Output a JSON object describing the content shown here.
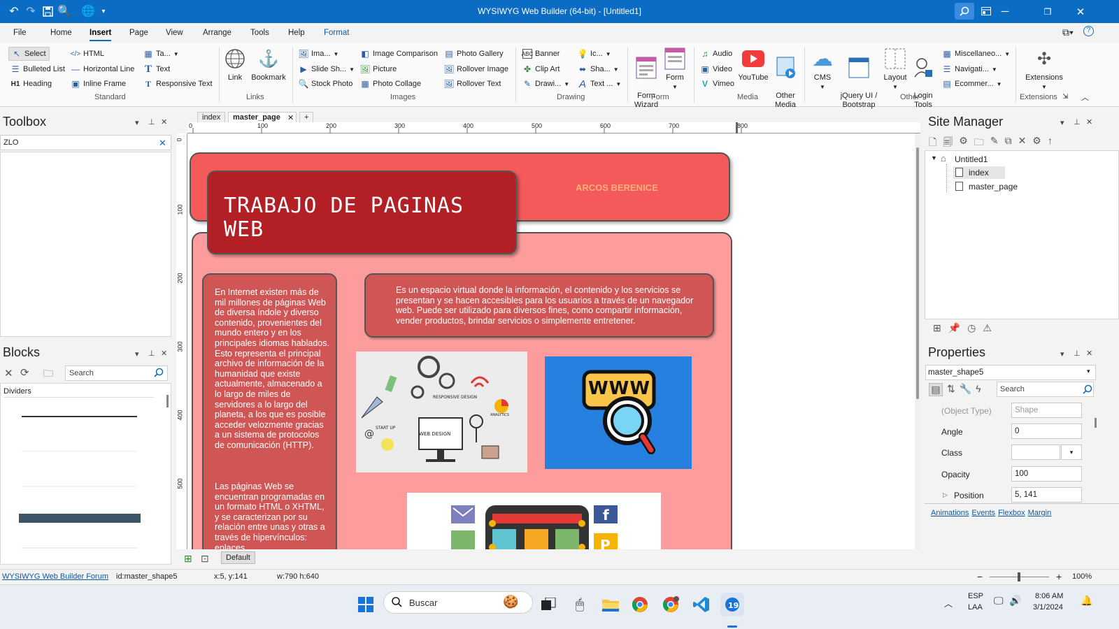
{
  "app": {
    "title": "WYSIWYG Web Builder (64-bit) - [Untitled1]"
  },
  "menu": [
    "File",
    "Home",
    "Insert",
    "Page",
    "View",
    "Arrange",
    "Tools",
    "Help",
    "Format"
  ],
  "ribbon": {
    "standard": {
      "select": "Select",
      "html": "HTML",
      "table": "Ta...",
      "bulleted_list": "Bulleted List",
      "horizontal_line": "Horizontal Line",
      "text": "Text",
      "heading": "Heading",
      "inline_frame": "Inline Frame",
      "responsive_text": "Responsive Text",
      "group": "Standard"
    },
    "links": {
      "link": "Link",
      "bookmark": "Bookmark",
      "group": "Links"
    },
    "images": {
      "image": "Ima...",
      "slide_show": "Slide Sh...",
      "stock_photo": "Stock Photo",
      "image_comparison": "Image Comparison",
      "picture": "Picture",
      "photo_collage": "Photo Collage",
      "photo_gallery": "Photo Gallery",
      "rollover_image": "Rollover Image",
      "rollover_text": "Rollover Text",
      "group": "Images"
    },
    "drawing": {
      "banner": "Banner",
      "clip_art": "Clip Art",
      "drawing": "Drawi...",
      "icon": "Ic...",
      "shape": "Sha...",
      "text_art": "Text ...",
      "group": "Drawing"
    },
    "form": {
      "form_wizard": "Form\nWizard",
      "form": "Form",
      "group": "Form"
    },
    "media": {
      "audio": "Audio",
      "video": "Video",
      "vimeo": "Vimeo",
      "youtube": "YouTube",
      "other_media": "Other\nMedia",
      "group": "Media"
    },
    "other": {
      "cms": "CMS",
      "jquery": "jQuery UI /\nBootstrap",
      "layout": "Layout",
      "login_tools": "Login\nTools",
      "miscellaneous": "Miscellaneo...",
      "navigation": "Navigati...",
      "ecommerce": "Ecommer...",
      "group": "Other"
    },
    "extensions": {
      "extensions": "Extensions",
      "group": "Extensions"
    }
  },
  "toolbox": {
    "title": "Toolbox",
    "search_value": "ZLO"
  },
  "blocks": {
    "title": "Blocks",
    "search_placeholder": "Search",
    "category": "Dividers"
  },
  "tabs": [
    "index",
    "master_page",
    "+"
  ],
  "ruler": {
    "h_ticks": [
      "0",
      "100",
      "200",
      "300",
      "400",
      "500",
      "600",
      "700",
      "800"
    ],
    "v_ticks": [
      "0",
      "100",
      "200",
      "300",
      "400",
      "500"
    ]
  },
  "page_content": {
    "header_name": "ARCOS BERENICE",
    "title": "TRABAJO DE PAGINAS WEB",
    "left_text_1": "En Internet existen más de mil millones de páginas Web de diversa índole y diverso contenido, provenientes del mundo entero y en los principales idiomas hablados. Esto representa el principal archivo de información de la humanidad que existe actualmente, almacenado a lo largo de miles de servidores a lo largo del planeta, a los que es posible acceder velozmente gracias a un sistema de protocolos de comunicación (HTTP).",
    "left_text_2": "Las páginas Web se encuentran programadas en un formato HTML o XHTML, y se caracterizan por su relación entre unas y otras a través de hipervínculos: enlaces",
    "right_text": "Es un espacio virtual donde la información, el contenido y los servicios se presentan y se hacen accesibles para los usuarios a través de un navegador web. Puede ser utilizado para diversos fines, como compartir información, vender productos, brindar servicios o simplemente entretener.",
    "img_labels": [
      "RESPONSIVE DESIGN",
      "ANALYTICS",
      "START UP",
      "WEB DESIGN"
    ],
    "www_label": "WWW"
  },
  "canvas_footer": {
    "default_btn": "Default"
  },
  "site_manager": {
    "title": "Site Manager",
    "root": "Untitled1",
    "pages": [
      "index",
      "master_page"
    ]
  },
  "properties": {
    "title": "Properties",
    "object": "master_shape5",
    "search_placeholder": "Search",
    "rows": [
      {
        "label": "(Object Type)",
        "value": "Shape"
      },
      {
        "label": "Angle",
        "value": "0"
      },
      {
        "label": "Class",
        "value": ""
      },
      {
        "label": "Opacity",
        "value": "100"
      },
      {
        "label": "Position",
        "value": "5, 141"
      }
    ],
    "links": [
      "Animations",
      "Events",
      "Flexbox",
      "Margin"
    ]
  },
  "statusbar": {
    "forum": "WYSIWYG Web Builder Forum",
    "id": "id:master_shape5",
    "pos": "x:5, y:141",
    "size": "w:790 h:640",
    "zoom": "100%"
  },
  "taskbar": {
    "search_placeholder": "Buscar",
    "lang1": "ESP",
    "lang2": "LAA",
    "time": "8:06 AM",
    "date": "3/1/2024"
  },
  "colors": {
    "titlebar": "#0b6cc4",
    "header_shape": "#f45a59",
    "title_box": "#b21f24",
    "body_shape": "#fd9c9c",
    "text_box": "#d05656"
  }
}
